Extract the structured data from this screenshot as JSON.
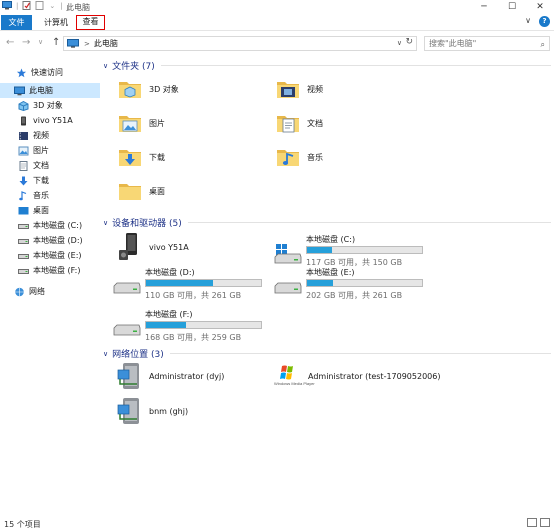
{
  "window": {
    "title": "此电脑",
    "minimize": "─",
    "maximize": "☐",
    "close": "✕"
  },
  "ribbon": {
    "tabs": [
      {
        "label": "文件"
      },
      {
        "label": "计算机"
      },
      {
        "label": "查看"
      }
    ],
    "expand": "∨"
  },
  "nav": {
    "back": "←",
    "forward": "→",
    "recent": "∨",
    "up": "↑",
    "crumb_sep": ">",
    "address": "此电脑",
    "dropdown": "∨",
    "refresh": "↻",
    "search_placeholder": "搜索\"此电脑\"",
    "search_icon": "⌕"
  },
  "sidebar": {
    "items": [
      {
        "label": "快速访问",
        "icon": "star-icon"
      },
      {
        "label": "此电脑",
        "icon": "computer-icon"
      },
      {
        "label": "3D 对象",
        "icon": "3d-objects-icon"
      },
      {
        "label": "vivo Y51A",
        "icon": "phone-icon"
      },
      {
        "label": "视频",
        "icon": "video-icon"
      },
      {
        "label": "图片",
        "icon": "pictures-icon"
      },
      {
        "label": "文档",
        "icon": "documents-icon"
      },
      {
        "label": "下载",
        "icon": "download-icon"
      },
      {
        "label": "音乐",
        "icon": "music-icon"
      },
      {
        "label": "桌面",
        "icon": "desktop-icon"
      },
      {
        "label": "本地磁盘 (C:)",
        "icon": "drive-icon"
      },
      {
        "label": "本地磁盘 (D:)",
        "icon": "drive-icon"
      },
      {
        "label": "本地磁盘 (E:)",
        "icon": "drive-icon"
      },
      {
        "label": "本地磁盘 (F:)",
        "icon": "drive-icon"
      },
      {
        "label": "网络",
        "icon": "network-icon"
      }
    ]
  },
  "groups": {
    "folders": {
      "title": "文件夹 (7)",
      "chevron": "∨"
    },
    "drives": {
      "title": "设备和驱动器 (5)",
      "chevron": "∨"
    },
    "network": {
      "title": "网络位置 (3)",
      "chevron": "∨"
    }
  },
  "folders": [
    {
      "name": "3D 对象",
      "icon": "3d-objects-folder-icon"
    },
    {
      "name": "视频",
      "icon": "video-folder-icon"
    },
    {
      "name": "图片",
      "icon": "pictures-folder-icon"
    },
    {
      "name": "文档",
      "icon": "documents-folder-icon"
    },
    {
      "name": "下载",
      "icon": "download-folder-icon"
    },
    {
      "name": "音乐",
      "icon": "music-folder-icon"
    },
    {
      "name": "桌面",
      "icon": "desktop-folder-icon"
    }
  ],
  "devices": [
    {
      "name": "vivo Y51A",
      "icon": "phone-icon"
    },
    {
      "name": "本地磁盘 (C:)",
      "info": "117 GB 可用，共 150 GB",
      "used_fraction": 0.22,
      "icon": "windows-drive-icon"
    },
    {
      "name": "本地磁盘 (D:)",
      "info": "110 GB 可用，共 261 GB",
      "used_fraction": 0.58,
      "icon": "drive-icon"
    },
    {
      "name": "本地磁盘 (E:)",
      "info": "202 GB 可用，共 261 GB",
      "used_fraction": 0.23,
      "icon": "drive-icon"
    },
    {
      "name": "本地磁盘 (F:)",
      "info": "168 GB 可用，共 259 GB",
      "used_fraction": 0.35,
      "icon": "drive-icon"
    }
  ],
  "network_locations": [
    {
      "name": "Administrator (dyj)",
      "icon": "network-location-icon"
    },
    {
      "name": "Administrator (test-1709052006)",
      "icon": "windows-media-player-icon",
      "logo_text": "Windows Media Player"
    },
    {
      "name": "bnm (ghj)",
      "icon": "network-location-icon"
    }
  ],
  "status": {
    "count": "15 个项目"
  },
  "colors": {
    "accent": "#1979ca",
    "drive_fill": "#26a0da",
    "selected": "#cce8ff",
    "group_title": "#1e3287"
  }
}
